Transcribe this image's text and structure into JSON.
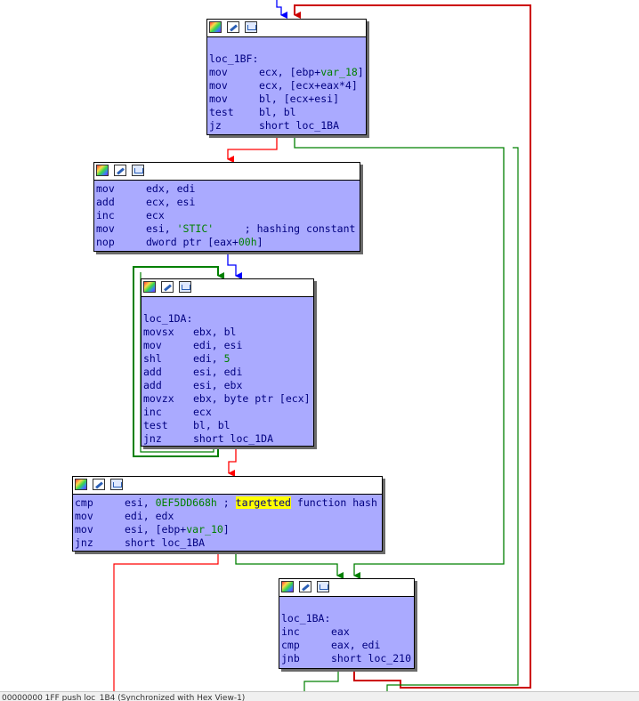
{
  "nodes": {
    "loc_1bf": {
      "label": "loc_1BF:",
      "lines": [
        {
          "mn": "mov",
          "a": "ecx, [ebp+",
          "v": "var_18",
          "b": "]"
        },
        {
          "mn": "mov",
          "a": "ecx, [ecx+eax*4]"
        },
        {
          "mn": "mov",
          "a": "bl, [ecx+esi]"
        },
        {
          "mn": "test",
          "a": "bl, bl"
        },
        {
          "mn": "jz",
          "a": "short loc_1BA"
        }
      ]
    },
    "init": {
      "lines": [
        {
          "mn": "mov",
          "a": "edx, edi"
        },
        {
          "mn": "add",
          "a": "ecx, esi"
        },
        {
          "mn": "inc",
          "a": "ecx"
        },
        {
          "mn": "mov",
          "a": "esi, ",
          "s": "'STIC'",
          "c": "     ; hashing constant"
        },
        {
          "mn": "nop",
          "a": "dword ptr [eax+",
          "n": "00h",
          "b": "]"
        }
      ]
    },
    "loc_1da": {
      "label": "loc_1DA:",
      "lines": [
        {
          "mn": "movsx",
          "a": "ebx, bl"
        },
        {
          "mn": "mov",
          "a": "edi, esi"
        },
        {
          "mn": "shl",
          "a": "edi, ",
          "n": "5"
        },
        {
          "mn": "add",
          "a": "esi, edi"
        },
        {
          "mn": "add",
          "a": "esi, ebx"
        },
        {
          "mn": "movzx",
          "a": "ebx, byte ptr [ecx]"
        },
        {
          "mn": "inc",
          "a": "ecx"
        },
        {
          "mn": "test",
          "a": "bl, bl"
        },
        {
          "mn": "jnz",
          "a": "short loc_1DA"
        }
      ]
    },
    "cmp": {
      "lines": [
        {
          "mn": "cmp",
          "a": "esi, ",
          "n": "0EF5DD668h",
          "c1": " ; ",
          "hl": "targetted",
          "c": " function hash"
        },
        {
          "mn": "mov",
          "a": "edi, edx"
        },
        {
          "mn": "mov",
          "a": "esi, [ebp+",
          "v": "var_10",
          "b": "]"
        },
        {
          "mn": "jnz",
          "a": "short loc_1BA"
        }
      ]
    },
    "loc_1ba": {
      "label": "loc_1BA:",
      "lines": [
        {
          "mn": "inc",
          "a": "eax"
        },
        {
          "mn": "cmp",
          "a": "eax, edi"
        },
        {
          "mn": "jnb",
          "a": "short loc_210"
        }
      ]
    }
  },
  "status_text": "00000000 1FF   push  loc_1B4  (Synchronized with Hex View-1)",
  "icons": [
    "color-palette-icon",
    "edit-icon",
    "graph-overview-icon"
  ],
  "colors": {
    "node_bg": "#aaaaff",
    "true_edge": "#008000",
    "false_edge": "#ff0000",
    "uncond_edge": "#0000ff",
    "back_edge": "#cc0000"
  }
}
